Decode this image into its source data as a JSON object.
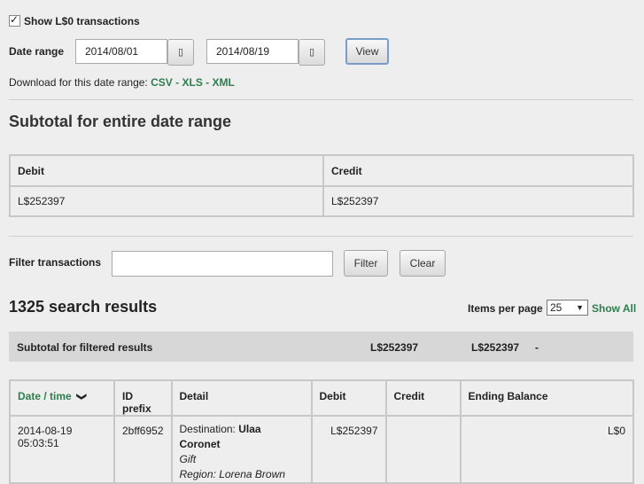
{
  "show_zero": {
    "label": "Show L$0 transactions",
    "checked": true
  },
  "date_range": {
    "label": "Date range",
    "start": "2014/08/01",
    "end": "2014/08/19",
    "calendar_glyph": "▯",
    "view_label": "View"
  },
  "download": {
    "prefix": "Download for this date range:",
    "csv": "CSV",
    "sep1": "-",
    "xls": "XLS",
    "sep2": "-",
    "xml": "XML"
  },
  "subtotal_entire": {
    "heading": "Subtotal for entire date range",
    "debit_header": "Debit",
    "credit_header": "Credit",
    "debit_value": "L$252397",
    "credit_value": "L$252397"
  },
  "filter": {
    "label": "Filter transactions",
    "value": "",
    "filter_label": "Filter",
    "clear_label": "Clear"
  },
  "results": {
    "count_text": "1325 search results",
    "items_per_page_label": "Items per page",
    "items_per_page_value": "25",
    "show_all_label": "Show All",
    "subtotal_label": "Subtotal for filtered results",
    "subtotal_debit": "L$252397",
    "subtotal_credit": "L$252397",
    "subtotal_balance": "-"
  },
  "table": {
    "headers": {
      "date": "Date / time",
      "id": "ID prefix",
      "detail": "Detail",
      "debit": "Debit",
      "credit": "Credit",
      "balance": "Ending Balance"
    },
    "rows": [
      {
        "date": "2014-08-19 05:03:51",
        "id": "2bff6952",
        "detail_prefix": "Destination:",
        "detail_name": "Ulaa Coronet",
        "detail_type": "Gift",
        "detail_region": "Region: Lorena Brown",
        "debit": "L$252397",
        "credit": "",
        "balance": "L$0"
      }
    ]
  },
  "colors": {
    "link": "#2e7d4f",
    "background": "#eeeeee",
    "border": "#c8c8c8"
  }
}
